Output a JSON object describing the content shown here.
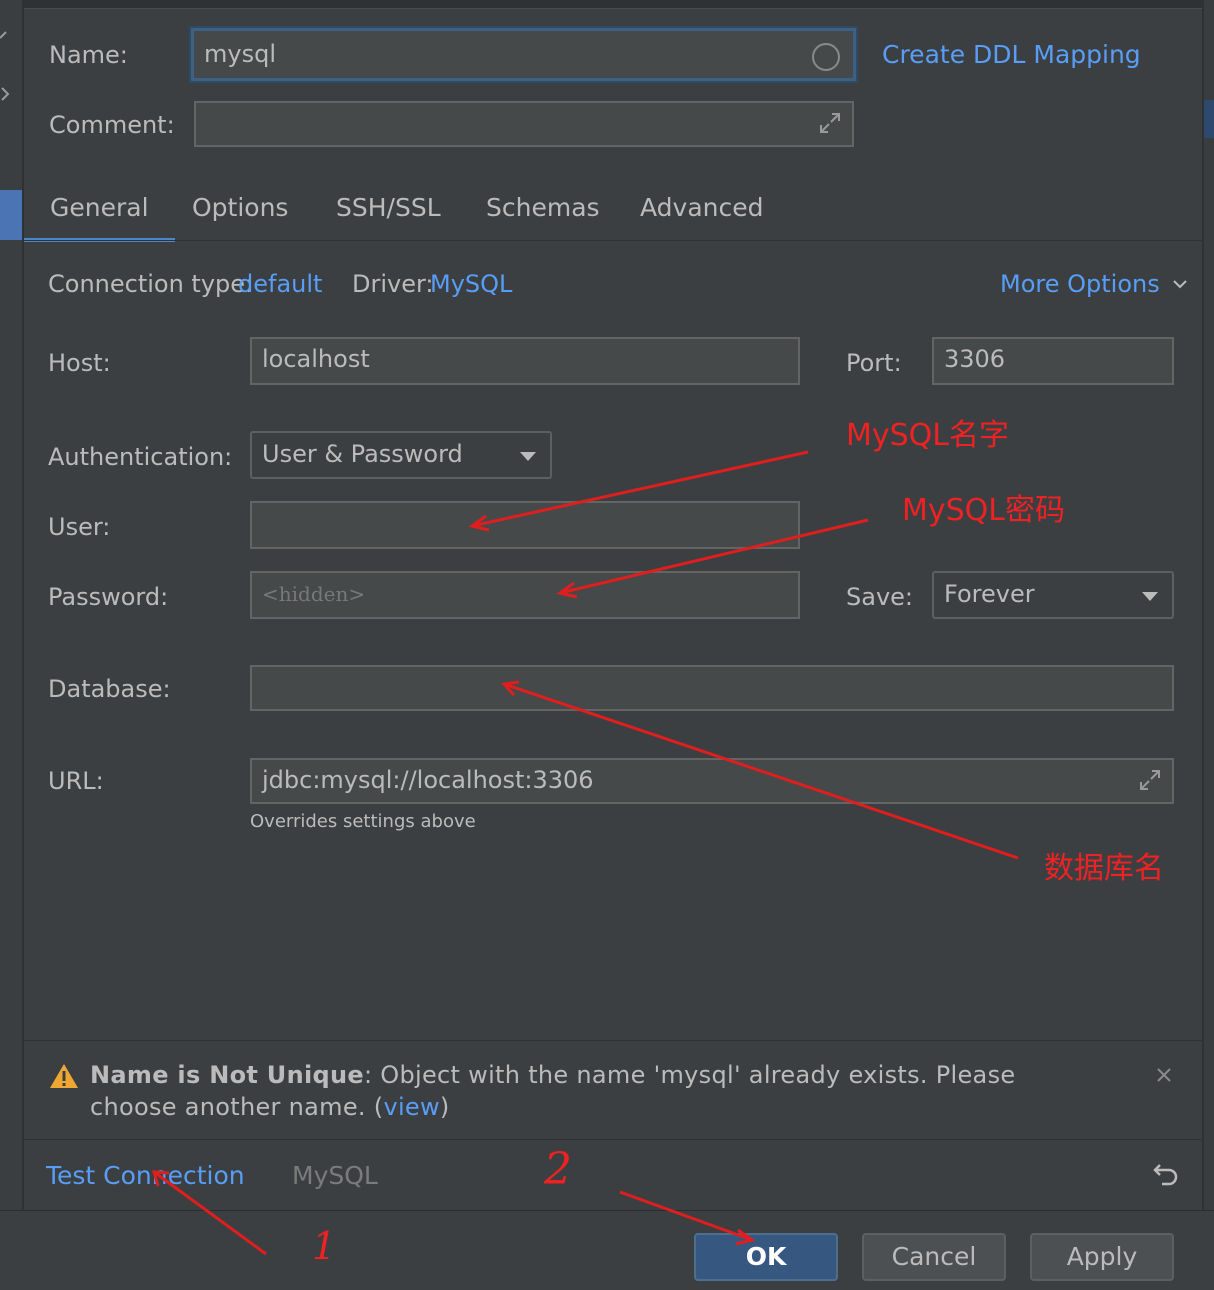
{
  "header": {
    "name_label": "Name:",
    "name_value": "mysql",
    "ddl_link": "Create DDL Mapping",
    "comment_label": "Comment:",
    "comment_value": ""
  },
  "tabs": [
    {
      "label": "General",
      "active": true
    },
    {
      "label": "Options"
    },
    {
      "label": "SSH/SSL"
    },
    {
      "label": "Schemas"
    },
    {
      "label": "Advanced"
    }
  ],
  "connection": {
    "type_label": "Connection type:",
    "type_value": "default",
    "driver_label": "Driver:",
    "driver_value": "MySQL",
    "more_options": "More Options"
  },
  "form": {
    "host_label": "Host:",
    "host_value": "localhost",
    "port_label": "Port:",
    "port_value": "3306",
    "auth_label": "Authentication:",
    "auth_value": "User & Password",
    "user_label": "User:",
    "user_value": "",
    "password_label": "Password:",
    "password_placeholder": "<hidden>",
    "save_label": "Save:",
    "save_value": "Forever",
    "database_label": "Database:",
    "database_value": "",
    "url_label": "URL:",
    "url_value": "jdbc:mysql://localhost:3306",
    "url_hint": "Overrides settings above"
  },
  "warning": {
    "title": "Name is Not Unique",
    "message_prefix": ": Object with the name 'mysql' already exists. Please choose another name. (",
    "view_link": "view",
    "message_suffix": ")"
  },
  "footer": {
    "test_connection": "Test Connection",
    "driver_name": "MySQL",
    "ok": "OK",
    "cancel": "Cancel",
    "apply": "Apply"
  },
  "annotations": {
    "mysql_name": "MySQL名字",
    "mysql_password": "MySQL密码",
    "database_name": "数据库名",
    "step1": "1",
    "step2": "2"
  },
  "colors": {
    "background": "#3c3f41",
    "link": "#589df6",
    "primary_button": "#365880",
    "annotation": "#ee2222",
    "warning_icon": "#f0a732"
  }
}
